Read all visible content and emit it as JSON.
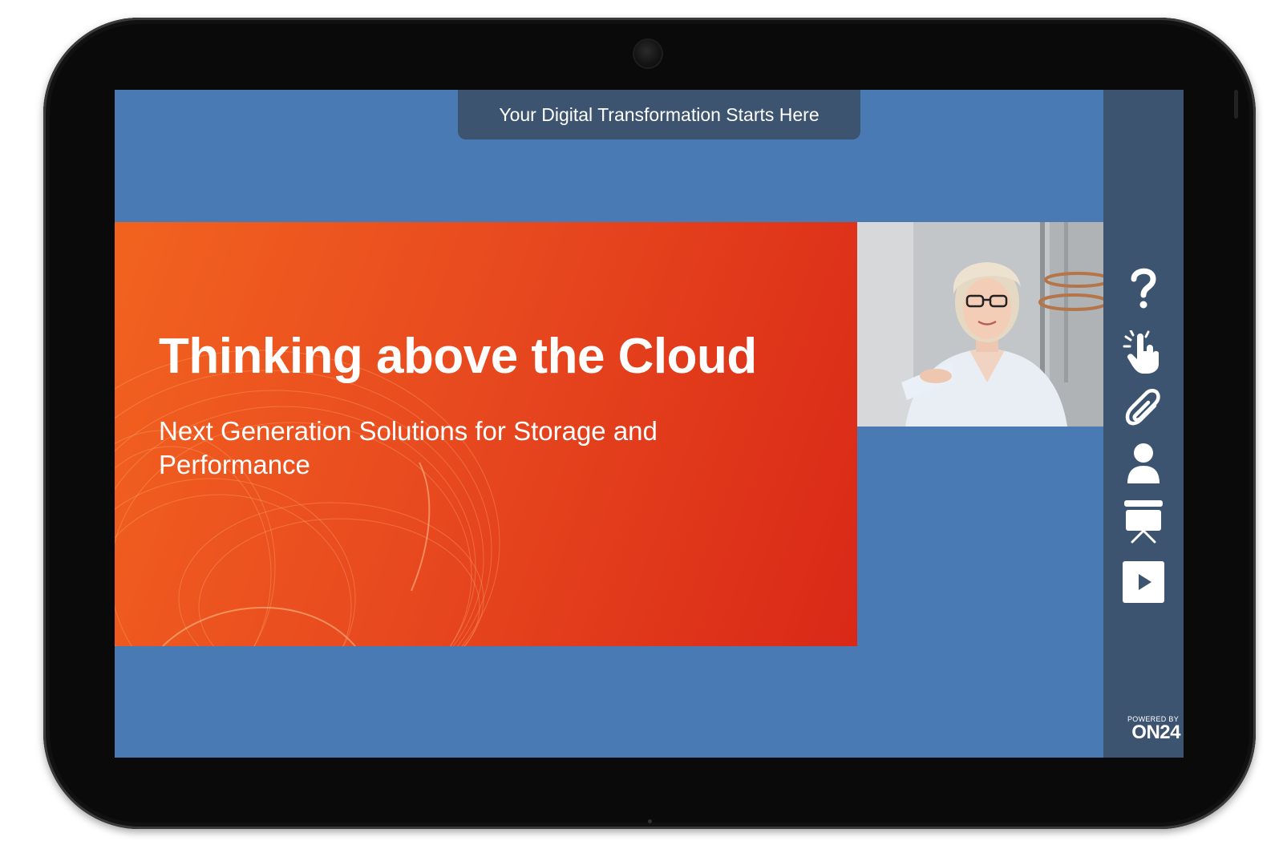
{
  "header": {
    "title": "Your Digital Transformation Starts Here"
  },
  "slide": {
    "title": "Thinking above the Cloud",
    "subtitle": "Next Generation Solutions for Storage and Performance"
  },
  "presenter": {
    "icon": "presenter-video-feed"
  },
  "toolbar": {
    "items": [
      {
        "name": "qa-icon",
        "icon": "question-mark"
      },
      {
        "name": "engage-icon",
        "icon": "pointer-hand"
      },
      {
        "name": "resources-icon",
        "icon": "paperclip"
      },
      {
        "name": "speaker-bio-icon",
        "icon": "person"
      },
      {
        "name": "slides-icon",
        "icon": "presentation-board"
      },
      {
        "name": "media-player-icon",
        "icon": "play"
      }
    ],
    "powered_by_label": "POWERED BY",
    "brand": "ON24"
  },
  "colors": {
    "screen_bg": "#4a7ab3",
    "bar_bg": "#3d5470",
    "slide_start": "#f2631f",
    "slide_end": "#d92817"
  }
}
